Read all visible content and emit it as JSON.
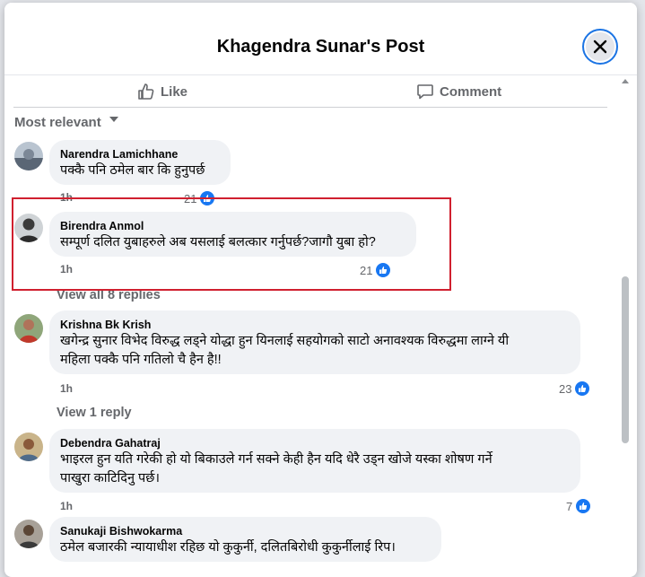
{
  "dialog": {
    "title": "Khagendra Sunar's Post",
    "close_icon": "close-icon"
  },
  "actions": {
    "like_label": "Like",
    "comment_label": "Comment"
  },
  "sort": {
    "label": "Most relevant"
  },
  "comments": [
    {
      "name": "Narendra Lamichhane",
      "text": "पक्कै पनि ठमेल बार कि हुनुपर्छ",
      "time": "1h",
      "reactions": "21"
    },
    {
      "name": "Birendra Anmol",
      "text": "सम्पूर्ण दलित युबाहरुले अब यसलाई बलत्कार गर्नुपर्छ?जागौ युबा हो?",
      "time": "1h",
      "reactions": "21",
      "replies": "View all 8 replies"
    },
    {
      "name": "Krishna Bk Krish",
      "text_line1": "खगेन्द्र सुनार विभेद विरुद्ध लड्ने योद्धा हुन यिनलाई सहयोगको साटो अनावश्यक विरुद्धमा लाग्ने यी",
      "text_line2": "महिला पक्कै पनि गतिलो चै हैन है!!",
      "time": "1h",
      "reactions": "23",
      "replies": "View 1 reply"
    },
    {
      "name": "Debendra Gahatraj",
      "text_line1": "भाइरल हुन यति गरेकी हो यो बिकाउले गर्न सक्ने केही हैन यदि धेरै उड्न खोजे यस्का शोषण गर्ने",
      "text_line2": "पाखुरा काटिदिनु पर्छ।",
      "time": "1h",
      "reactions": "7"
    },
    {
      "name": "Sanukaji Bishwokarma",
      "text": "ठमेल बजारकी न्यायाधीश रहिछ यो कुकुर्नी, दलितबिरोधी कुकुर्नीलाई रिप।"
    }
  ],
  "colors": {
    "accent": "#1877f2",
    "highlight": "#d0202f"
  }
}
